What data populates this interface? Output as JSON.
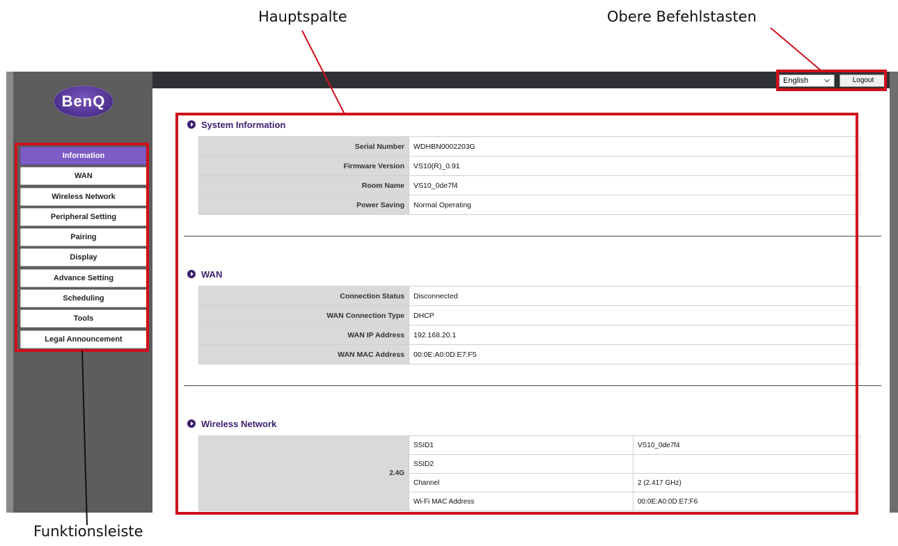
{
  "annotations": {
    "main_column": "Hauptspalte",
    "top_buttons": "Obere Befehlstasten",
    "function_bar": "Funktionsleiste"
  },
  "brand": {
    "logo_text": "BenQ",
    "accent": "#7d5cc6",
    "highlight": "#d0101c"
  },
  "header": {
    "language": "English",
    "language_icon": "chevron-down-icon",
    "logout": "Logout"
  },
  "sidebar": {
    "items": [
      {
        "label": "Information",
        "active": true
      },
      {
        "label": "WAN"
      },
      {
        "label": "Wireless Network"
      },
      {
        "label": "Peripheral Setting"
      },
      {
        "label": "Pairing"
      },
      {
        "label": "Display"
      },
      {
        "label": "Advance Setting"
      },
      {
        "label": "Scheduling"
      },
      {
        "label": "Tools"
      },
      {
        "label": "Legal Announcement"
      }
    ]
  },
  "system": {
    "title": "System Information",
    "rows": [
      {
        "label": "Serial Number",
        "value": "WDHBN0002203G"
      },
      {
        "label": "Firmware Version",
        "value": "VS10(R)_0.91"
      },
      {
        "label": "Room Name",
        "value": "VS10_0de7f4"
      },
      {
        "label": "Power Saving",
        "value": "Normal Operating"
      }
    ]
  },
  "wan": {
    "title": "WAN",
    "rows": [
      {
        "label": "Connection Status",
        "value": "Disconnected"
      },
      {
        "label": "WAN Connection Type",
        "value": "DHCP"
      },
      {
        "label": "WAN IP Address",
        "value": "192.168.20.1"
      },
      {
        "label": "WAN MAC Address",
        "value": "00:0E:A0:0D:E7:F5"
      }
    ]
  },
  "wireless": {
    "title": "Wireless Network",
    "band": "2.4G",
    "rows": [
      {
        "key": "SSID1",
        "value": "VS10_0de7f4"
      },
      {
        "key": "SSID2",
        "value": ""
      },
      {
        "key": "Channel",
        "value": "2 (2.417 GHz)"
      },
      {
        "key": "Wi-Fi MAC Address",
        "value": "00:0E:A0:0D:E7:F6"
      }
    ]
  }
}
